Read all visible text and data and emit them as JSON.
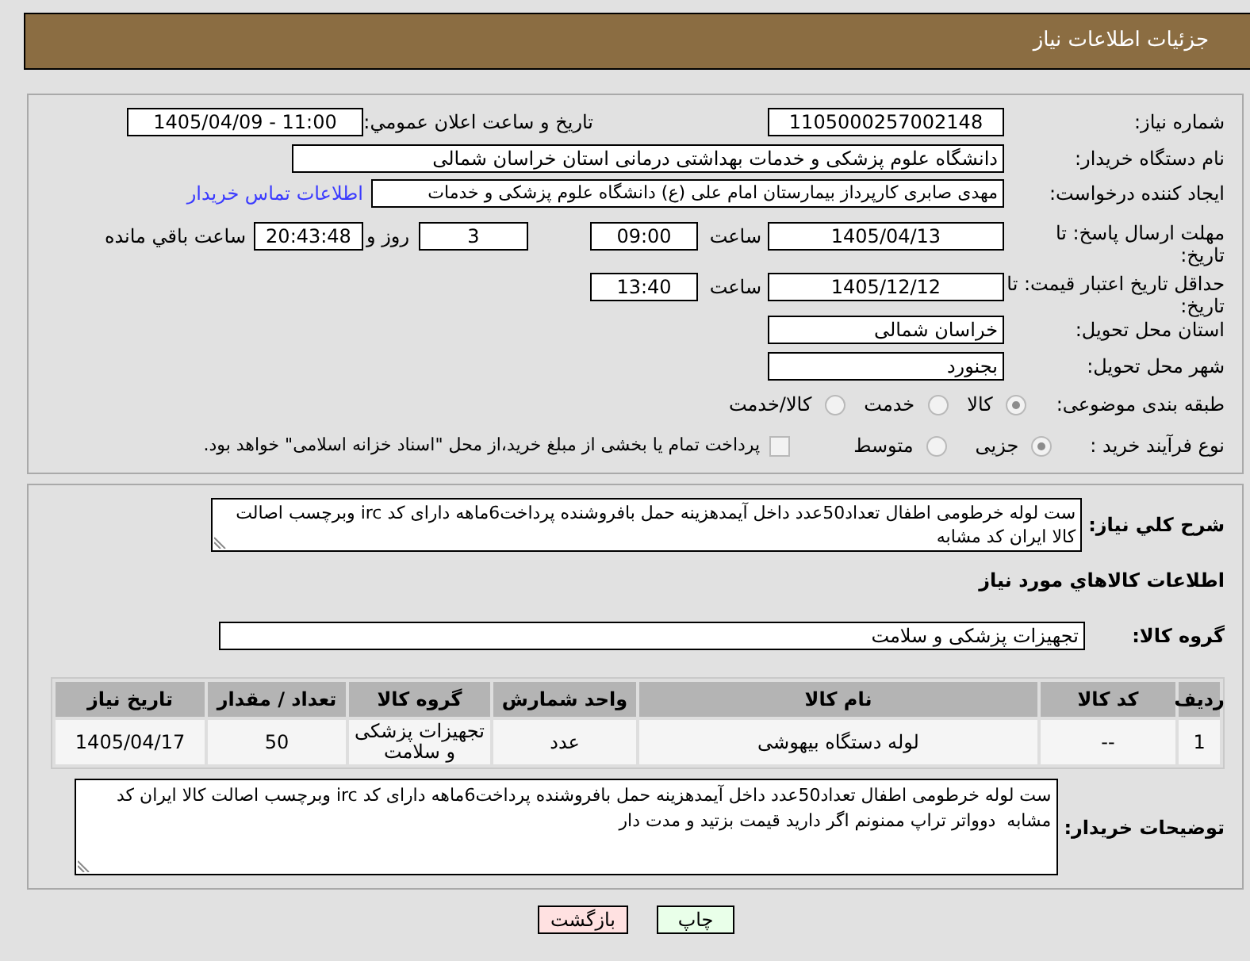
{
  "header": {
    "title": "جزئیات اطلاعات نیاز"
  },
  "request": {
    "need_number": {
      "label": "شماره نیاز:",
      "value": "1105000257002148"
    },
    "announcement": {
      "label": "تاریخ و ساعت اعلان عمومي:",
      "value": "1405/04/09 - 11:00"
    },
    "buyer_organization": {
      "label": "نام دستگاه خریدار:",
      "value": "دانشگاه علوم پزشکی و خدمات بهداشتی درمانی استان خراسان شمالی"
    },
    "requester": {
      "label": "ایجاد کننده درخواست:",
      "value": "مهدی صابری کارپرداز بیمارستان امام علی (ع) دانشگاه علوم پزشکی و خدمات",
      "contact_link": "اطلاعات تماس خریدار"
    },
    "response_deadline": {
      "label": "مهلت ارسال پاسخ: تا تاریخ:",
      "date": "1405/04/13",
      "time_label": "ساعت",
      "time": "09:00",
      "days": "3",
      "days_label": "روز و",
      "remaining": "20:43:48",
      "remaining_label": "ساعت باقي مانده"
    },
    "price_validity": {
      "label": "حداقل تاریخ اعتبار قیمت: تا تاریخ:",
      "date": "1405/12/12",
      "time_label": "ساعت",
      "time": "13:40"
    },
    "delivery_province": {
      "label": "استان محل تحویل:",
      "value": "خراسان شمالی"
    },
    "delivery_city": {
      "label": "شهر محل تحویل:",
      "value": "بجنورد"
    },
    "subject_category": {
      "label": "طبقه بندی موضوعی:",
      "options": [
        {
          "label": "کالا",
          "selected": true
        },
        {
          "label": "خدمت",
          "selected": false
        },
        {
          "label": "کالا/خدمت",
          "selected": false
        }
      ]
    },
    "purchase_process": {
      "label": "نوع فرآیند خرید :",
      "options": [
        {
          "label": "جزیی",
          "selected": true
        },
        {
          "label": "متوسط",
          "selected": false
        }
      ],
      "treasury_payment": {
        "label": "پرداخت تمام یا بخشی از مبلغ خرید،از محل \"اسناد خزانه اسلامی\" خواهد بود.",
        "checked": false
      }
    }
  },
  "summary": {
    "label": "شرح کلي نیاز:",
    "value": "ست لوله خرطومی اطفال تعداد50عدد داخل آیمدهزینه حمل بافروشنده پرداخت6ماهه دارای کد irc وبرچسب اصالت کالا ایران کد مشابه"
  },
  "goods": {
    "title": "اطلاعات کالاهاي مورد نیاز",
    "group": {
      "label": "گروه کالا:",
      "value": "تجهیزات پزشکی و سلامت"
    },
    "table": {
      "columns": [
        "ردیف",
        "کد کالا",
        "نام کالا",
        "واحد شمارش",
        "گروه کالا",
        "تعداد / مقدار",
        "تاریخ نیاز"
      ],
      "rows": [
        [
          "1",
          "--",
          "لوله دستگاه بیهوشی",
          "عدد",
          "تجهیزات پزشکی و سلامت",
          "50",
          "1405/04/17"
        ]
      ]
    }
  },
  "buyer_notes": {
    "label": "توضیحات خریدار:",
    "value": "ست لوله خرطومی اطفال تعداد50عدد داخل آیمدهزینه حمل بافروشنده پرداخت6ماهه دارای کد irc وبرچسب اصالت کالا ایران کد مشابه  دوواتر تراپ ممنونم اگر دارید قیمت بزتید و مدت دار"
  },
  "buttons": [
    {
      "label": "چاپ",
      "kind": "print"
    },
    {
      "label": "بازگشت",
      "kind": "back"
    }
  ]
}
